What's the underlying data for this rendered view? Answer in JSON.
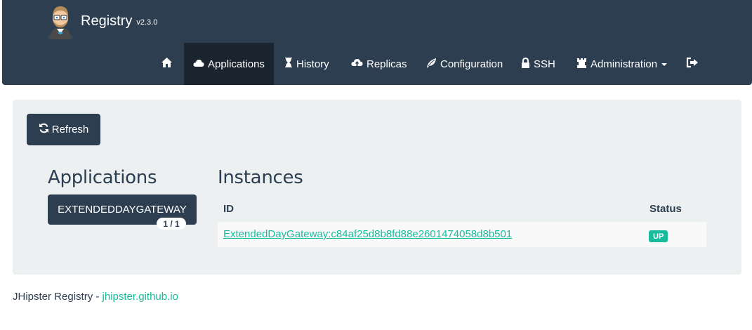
{
  "brand": {
    "name": "Registry",
    "version": "v2.3.0"
  },
  "nav": {
    "items": [
      {
        "label": "",
        "icon": "home-icon"
      },
      {
        "label": "Applications",
        "icon": "cloud-icon",
        "active": true
      },
      {
        "label": "History",
        "icon": "hourglass-icon"
      },
      {
        "label": "Replicas",
        "icon": "cloud-upload-icon"
      },
      {
        "label": "Configuration",
        "icon": "leaf-icon"
      },
      {
        "label": "SSH",
        "icon": "lock-icon"
      },
      {
        "label": "Administration",
        "icon": "tower-icon"
      },
      {
        "label": "",
        "icon": "logout-icon"
      }
    ]
  },
  "main": {
    "refresh_label": "Refresh",
    "applications_heading": "Applications",
    "applications": [
      {
        "name": "EXTENDEDDAYGATEWAY",
        "badge": "1 / 1"
      }
    ],
    "instances_heading": "Instances",
    "table": {
      "headers": [
        "ID",
        "Status"
      ],
      "rows": [
        {
          "id": "ExtendedDayGateway:c84af25d8b8fd88e2601474058d8b501",
          "status": "UP"
        }
      ]
    }
  },
  "footer": {
    "text": "JHipster Registry - ",
    "link": "jhipster.github.io"
  },
  "colors": {
    "navbar": "#2c3e50",
    "navbar_active": "#1a242f",
    "accent": "#18bc9c",
    "well": "#ecf0f1"
  }
}
